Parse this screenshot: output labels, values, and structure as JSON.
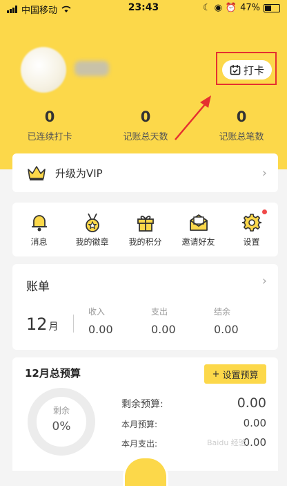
{
  "status_bar": {
    "carrier": "中国移动",
    "time": "23:43",
    "battery": "47%"
  },
  "header": {
    "checkin_label": "打卡",
    "stats": [
      {
        "value": "0",
        "label": "已连续打卡"
      },
      {
        "value": "0",
        "label": "记账总天数"
      },
      {
        "value": "0",
        "label": "记账总笔数"
      }
    ]
  },
  "vip": {
    "label": "升级为VIP"
  },
  "menu": [
    {
      "label": "消息",
      "icon": "bell-icon"
    },
    {
      "label": "我的徽章",
      "icon": "medal-icon"
    },
    {
      "label": "我的积分",
      "icon": "gift-icon"
    },
    {
      "label": "邀请好友",
      "icon": "envelope-icon"
    },
    {
      "label": "设置",
      "icon": "gear-icon"
    }
  ],
  "bill": {
    "title": "账单",
    "month": "12",
    "month_unit": "月",
    "income_label": "收入",
    "income_value": "0.00",
    "expense_label": "支出",
    "expense_value": "0.00",
    "balance_label": "结余",
    "balance_value": "0.00"
  },
  "budget": {
    "title": "12月总预算",
    "set_button": "设置预算",
    "ring_label": "剩余",
    "ring_value": "0%",
    "remaining_label": "剩余预算:",
    "remaining_value": "0.00",
    "month_budget_label": "本月预算:",
    "month_budget_value": "0.00",
    "month_spent_label": "本月支出:",
    "month_spent_value": "0.00"
  },
  "watermark": "Baidu 经验",
  "colors": {
    "accent": "#fcd84a",
    "highlight": "#e53030",
    "badge": "#f04848"
  }
}
